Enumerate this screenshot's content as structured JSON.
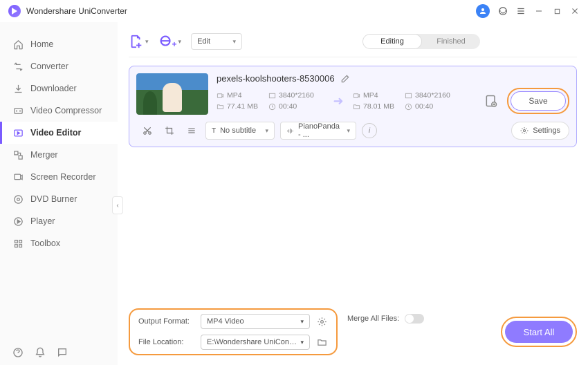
{
  "app": {
    "title": "Wondershare UniConverter"
  },
  "sidebar": {
    "items": [
      {
        "label": "Home"
      },
      {
        "label": "Converter"
      },
      {
        "label": "Downloader"
      },
      {
        "label": "Video Compressor"
      },
      {
        "label": "Video Editor"
      },
      {
        "label": "Merger"
      },
      {
        "label": "Screen Recorder"
      },
      {
        "label": "DVD Burner"
      },
      {
        "label": "Player"
      },
      {
        "label": "Toolbox"
      }
    ]
  },
  "toolbar": {
    "edit_label": "Edit",
    "tabs": {
      "editing": "Editing",
      "finished": "Finished"
    }
  },
  "file": {
    "name": "pexels-koolshooters-8530006",
    "source": {
      "format": "MP4",
      "resolution": "3840*2160",
      "size": "77.41 MB",
      "duration": "00:40"
    },
    "target": {
      "format": "MP4",
      "resolution": "3840*2160",
      "size": "78.01 MB",
      "duration": "00:40"
    },
    "subtitle_label": "No subtitle",
    "audio_label": "PianoPanda - ...",
    "settings_label": "Settings",
    "save_label": "Save"
  },
  "footer": {
    "output_format_label": "Output Format:",
    "output_format_value": "MP4 Video",
    "file_location_label": "File Location:",
    "file_location_value": "E:\\Wondershare UniConverter",
    "merge_label": "Merge All Files:",
    "start_all_label": "Start All"
  }
}
